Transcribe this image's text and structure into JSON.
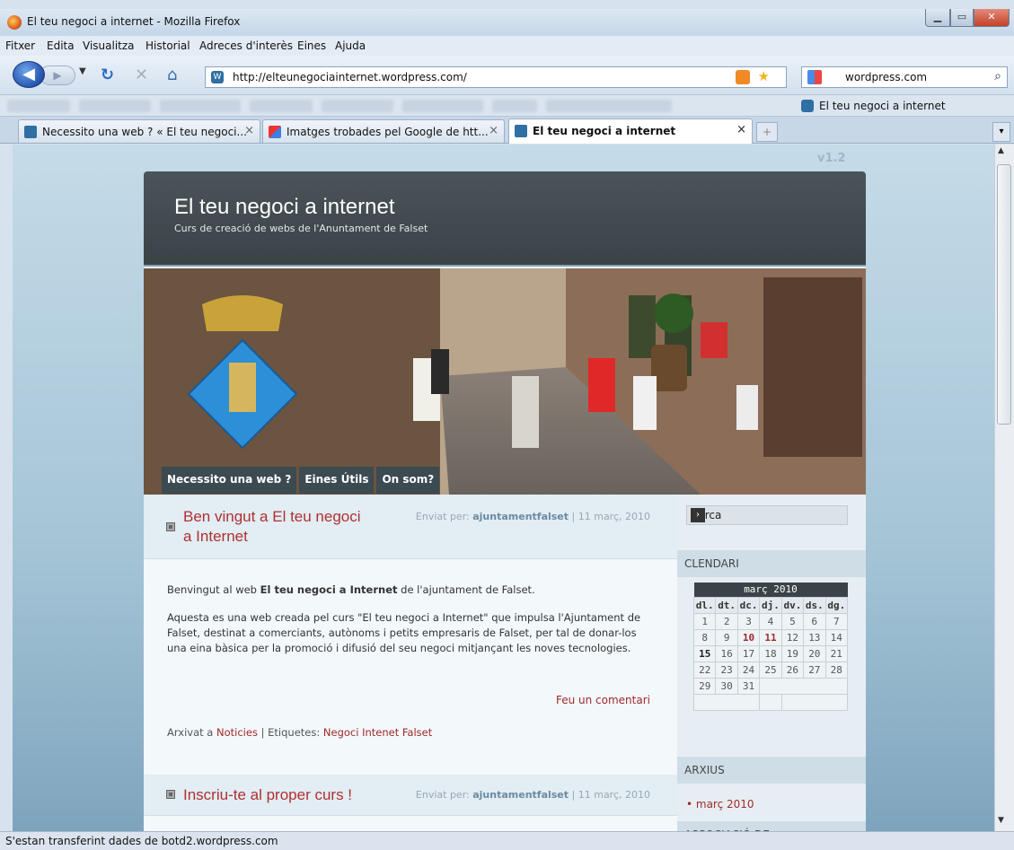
{
  "window": {
    "title": "El teu negoci a internet - Mozilla Firefox"
  },
  "menu": [
    "Fitxer",
    "Edita",
    "Visualitza",
    "Historial",
    "Adreces d'interès",
    "Eines",
    "Ajuda"
  ],
  "nav": {
    "url": "http://elteunegociainternet.wordpress.com/",
    "search_value": "wordpress.com"
  },
  "bookmarks": {
    "active_label": "El teu negoci a internet"
  },
  "tabs": [
    {
      "label": "Necessito una web ? « El teu negoci...",
      "close": "×"
    },
    {
      "label": "Imatges trobades pel Google de htt...",
      "close": "×"
    },
    {
      "label": "El teu negoci a internet",
      "close": "×"
    }
  ],
  "site": {
    "version_tag": "v1.2",
    "title": "El teu negoci a internet",
    "subtitle": "Curs de creació de webs de l'Anuntament de Falset",
    "nav": [
      "Necessito una web ?",
      "Eines Útils",
      "On som?"
    ]
  },
  "posts": [
    {
      "title": "Ben vingut a El teu negoci a Internet",
      "meta_prefix": "Enviat per:",
      "author": "ajuntamentfalset",
      "date": "| 11 març, 2010",
      "p1_pre": "Benvingut al web ",
      "p1_bold": "El teu negoci a Internet",
      "p1_post": " de l'ajuntament de Falset.",
      "p2": "Aquesta es una web creada pel curs \"El teu negoci a Internet\" que impulsa l'Ajuntament de Falset, destinat a comerciants, autònoms i petits empresaris de Falset, per tal de donar-los una eina bàsica per la promoció i difusió del seu negoci mitjançant les noves tecnologies.",
      "comment_link": "Feu un comentari",
      "archived_prefix": "Arxivat a ",
      "category": "Noticies",
      "tags_prefix": " | Etiquetes: ",
      "tags": "Negoci Intenet Falset"
    },
    {
      "title": "Inscriu-te al proper curs !",
      "meta_prefix": "Enviat per:",
      "author": "ajuntamentfalset",
      "date": "| 11 març, 2010"
    }
  ],
  "sidebar": {
    "search_placeholder": "Cerca",
    "search_go": "›",
    "calendar_title": "CLENDARI",
    "calendar": {
      "caption": "març 2010",
      "days": [
        "dl.",
        "dt.",
        "dc.",
        "dj.",
        "dv.",
        "ds.",
        "dg."
      ],
      "rows": [
        [
          "1",
          "2",
          "3",
          "4",
          "5",
          "6",
          "7"
        ],
        [
          "8",
          "9",
          "10",
          "11",
          "12",
          "13",
          "14"
        ],
        [
          "15",
          "16",
          "17",
          "18",
          "19",
          "20",
          "21"
        ],
        [
          "22",
          "23",
          "24",
          "25",
          "26",
          "27",
          "28"
        ],
        [
          "29",
          "30",
          "31",
          "",
          "",
          "",
          ""
        ]
      ]
    },
    "archives_title": "ARXIUS",
    "archive_link": "• març 2010",
    "next_title": "ASSOCIACIÓ DE"
  },
  "status": "S'estan transferint dades de botd2.wordpress.com"
}
